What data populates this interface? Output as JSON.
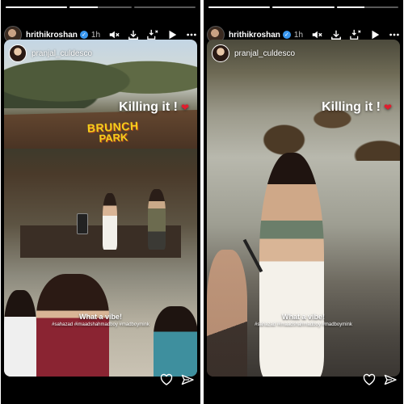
{
  "stories": [
    {
      "header": {
        "username": "hrithikroshan",
        "time": "1h"
      },
      "progress": [
        1.0,
        0.45,
        0.0
      ],
      "poster": {
        "name": "pranjal_culdesco"
      },
      "overlay": {
        "text": "Killing it !",
        "emoji": "❤"
      },
      "sign": {
        "line1": "BRUNCH",
        "line2": "PARK"
      },
      "caption": {
        "line1": "What a vibe!",
        "line2": "#sahazad #imaadshahmadboy #madboymink"
      }
    },
    {
      "header": {
        "username": "hrithikroshan",
        "time": "1h"
      },
      "progress": [
        1.0,
        1.0,
        0.45
      ],
      "poster": {
        "name": "pranjal_culdesco"
      },
      "overlay": {
        "text": "Killing it !",
        "emoji": "❤"
      },
      "caption": {
        "line1": "What a vibe!",
        "line2": "#sahazad #imaadshahmadboy #madboymink"
      }
    }
  ],
  "icons": {
    "verified": "verified-badge-icon",
    "mute": "speaker-mute-icon",
    "download": "download-icon",
    "save": "save-download-icon",
    "play": "play-icon",
    "more": "more-icon",
    "like": "heart-icon",
    "share": "send-icon"
  },
  "colors": {
    "verified": "#3897f0",
    "heart": "#e11d2e",
    "sign": "#f4d11c"
  }
}
